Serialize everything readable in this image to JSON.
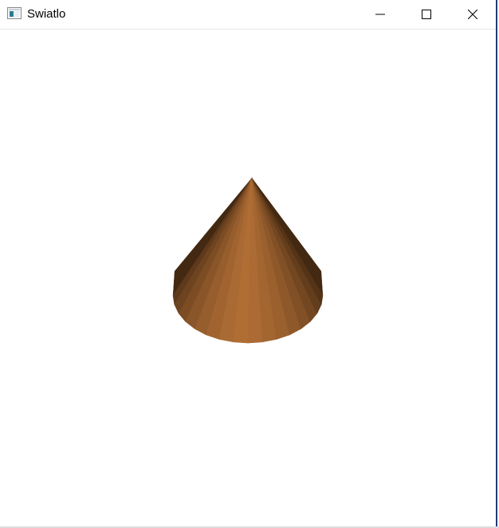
{
  "window": {
    "title": "Swiatlo",
    "app_icon": "window-app-icon",
    "controls": {
      "minimize_icon": "minimize-icon",
      "maximize_icon": "maximize-icon",
      "close_icon": "close-icon"
    }
  },
  "scene": {
    "object": "cone",
    "shading": "flat",
    "colors": {
      "light": "#b06e35",
      "dark": "#3a220f",
      "background": "#ffffff"
    }
  }
}
